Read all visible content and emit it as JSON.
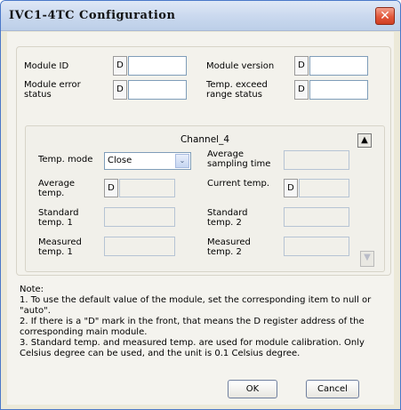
{
  "window": {
    "title": "IVC1-4TC Configuration",
    "close_symbol": "✕"
  },
  "module": {
    "id_label": "Module ID",
    "version_label": "Module version",
    "error_label_1": "Module error",
    "error_label_2": "status",
    "range_label_1": "Temp. exceed",
    "range_label_2": "range status",
    "d_prefix": "D"
  },
  "channel": {
    "title": "Channel_4",
    "temp_mode_label": "Temp. mode",
    "temp_mode_value": "Close",
    "avg_sampling_label_1": "Average",
    "avg_sampling_label_2": "sampling time",
    "avg_temp_label_1": "Average",
    "avg_temp_label_2": "temp.",
    "current_temp_label": "Current temp.",
    "std1_label_1": "Standard",
    "std1_label_2": "temp. 1",
    "std2_label_1": "Standard",
    "std2_label_2": "temp. 2",
    "meas1_label_1": "Measured",
    "meas1_label_2": "temp. 1",
    "meas2_label_1": "Measured",
    "meas2_label_2": "temp. 2",
    "d_prefix": "D",
    "scroll_up": "▲",
    "scroll_down": "▼",
    "dropdown_arrow": "⌄"
  },
  "note": {
    "heading": "Note:",
    "line1": "1. To use the default value of the module, set the corresponding item to null or \"auto\".",
    "line2": "2. If there is a \"D\" mark in the front, that means the D register address of the corresponding main module.",
    "line3": "3. Standard temp. and measured temp. are used for module calibration. Only Celsius degree can be used, and the unit is 0.1 Celsius degree."
  },
  "buttons": {
    "ok": "OK",
    "cancel": "Cancel"
  }
}
